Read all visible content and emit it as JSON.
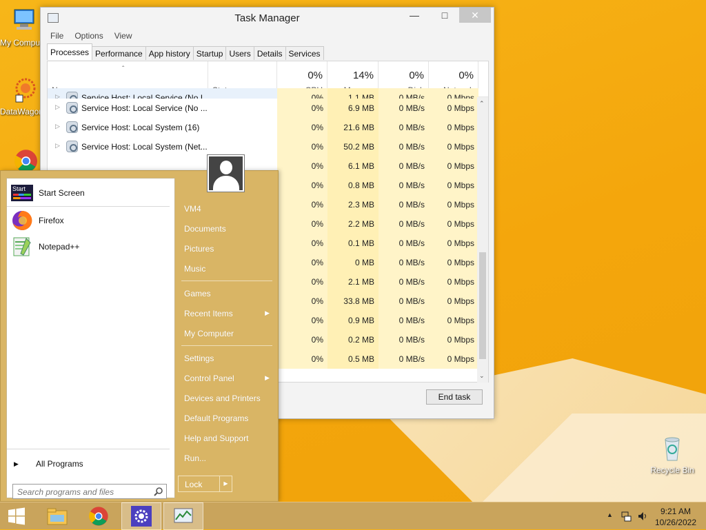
{
  "desktop": {
    "icons": [
      {
        "label": "My Computer"
      },
      {
        "label": "DataWagon"
      },
      {
        "label": "Recycle Bin"
      }
    ]
  },
  "task_manager": {
    "title": "Task Manager",
    "menu": [
      "File",
      "Options",
      "View"
    ],
    "tabs": [
      "Processes",
      "Performance",
      "App history",
      "Startup",
      "Users",
      "Details",
      "Services"
    ],
    "active_tab": "Processes",
    "columns": {
      "name": "Name",
      "status": "Status",
      "cpu": {
        "label": "CPU",
        "pct": "0%"
      },
      "memory": {
        "label": "Memory",
        "pct": "14%"
      },
      "disk": {
        "label": "Disk",
        "pct": "0%"
      },
      "network": {
        "label": "Network",
        "pct": "0%"
      }
    },
    "rows": [
      {
        "name": "Service Host: Local Service (No I...",
        "cpu": "0%",
        "mem": "1.1 MB",
        "disk": "0 MB/s",
        "net": "0 Mbps"
      },
      {
        "name": "Service Host: Local Service (No ...",
        "cpu": "0%",
        "mem": "6.9 MB",
        "disk": "0 MB/s",
        "net": "0 Mbps"
      },
      {
        "name": "Service Host: Local System (16)",
        "cpu": "0%",
        "mem": "21.6 MB",
        "disk": "0 MB/s",
        "net": "0 Mbps"
      },
      {
        "name": "Service Host: Local System (Net...",
        "cpu": "0%",
        "mem": "50.2 MB",
        "disk": "0 MB/s",
        "net": "0 Mbps"
      },
      {
        "name": "",
        "cpu": "0%",
        "mem": "6.1 MB",
        "disk": "0 MB/s",
        "net": "0 Mbps"
      },
      {
        "name": "",
        "cpu": "0%",
        "mem": "0.8 MB",
        "disk": "0 MB/s",
        "net": "0 Mbps"
      },
      {
        "name": "",
        "cpu": "0%",
        "mem": "2.3 MB",
        "disk": "0 MB/s",
        "net": "0 Mbps"
      },
      {
        "name": "",
        "cpu": "0%",
        "mem": "2.2 MB",
        "disk": "0 MB/s",
        "net": "0 Mbps"
      },
      {
        "name": "",
        "cpu": "0%",
        "mem": "0.1 MB",
        "disk": "0 MB/s",
        "net": "0 Mbps"
      },
      {
        "name": "",
        "cpu": "0%",
        "mem": "0 MB",
        "disk": "0 MB/s",
        "net": "0 Mbps"
      },
      {
        "name": "",
        "cpu": "0%",
        "mem": "2.1 MB",
        "disk": "0 MB/s",
        "net": "0 Mbps"
      },
      {
        "name": "",
        "cpu": "0%",
        "mem": "33.8 MB",
        "disk": "0 MB/s",
        "net": "0 Mbps"
      },
      {
        "name": "",
        "cpu": "0%",
        "mem": "0.9 MB",
        "disk": "0 MB/s",
        "net": "0 Mbps"
      },
      {
        "name": "",
        "cpu": "0%",
        "mem": "0.2 MB",
        "disk": "0 MB/s",
        "net": "0 Mbps"
      },
      {
        "name": "",
        "cpu": "0%",
        "mem": "0.5 MB",
        "disk": "0 MB/s",
        "net": "0 Mbps"
      }
    ],
    "end_task": "End task"
  },
  "start_menu": {
    "pinned": [
      {
        "label": "Start Screen",
        "icon": "start-screen-icon"
      },
      {
        "label": "Firefox",
        "icon": "firefox-icon"
      },
      {
        "label": "Notepad++",
        "icon": "notepadpp-icon"
      }
    ],
    "all_programs": "All Programs",
    "search_placeholder": "Search programs and files",
    "right_links": [
      {
        "label": "VM4"
      },
      {
        "label": "Documents"
      },
      {
        "label": "Pictures"
      },
      {
        "label": "Music"
      },
      {
        "label": "Games"
      },
      {
        "label": "Recent Items",
        "submenu": true
      },
      {
        "label": "My Computer"
      },
      {
        "label": "Settings"
      },
      {
        "label": "Control Panel",
        "submenu": true
      },
      {
        "label": "Devices and Printers"
      },
      {
        "label": "Default Programs"
      },
      {
        "label": "Help and Support"
      },
      {
        "label": "Run..."
      }
    ],
    "lock": "Lock",
    "start_tile_label": "Start"
  },
  "taskbar": {
    "time": "9:21 AM",
    "date": "10/26/2022"
  }
}
